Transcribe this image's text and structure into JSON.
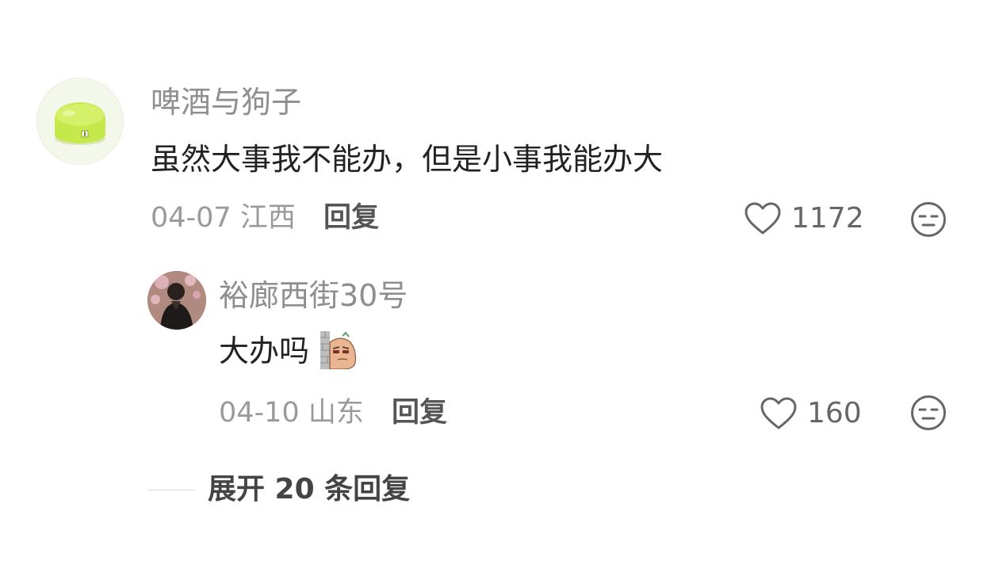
{
  "comment": {
    "username": "啤酒与狗子",
    "text": "虽然大事我不能办，但是小事我能办大",
    "date": "04-07",
    "location": "江西",
    "reply_label": "回复",
    "like_count": "1172",
    "avatar_icon": "green-toy-avatar",
    "like_icon": "heart-outline-icon",
    "dislike_icon": "unamused-face-icon"
  },
  "reply": {
    "username": "裕廊西街30号",
    "text": "大办吗",
    "emoji": "peeking-sticker",
    "date": "04-10",
    "location": "山东",
    "reply_label": "回复",
    "like_count": "160",
    "avatar_icon": "person-photo-avatar",
    "like_icon": "heart-outline-icon",
    "dislike_icon": "unamused-face-icon"
  },
  "expand": {
    "label": "展开 20 条回复"
  },
  "colors": {
    "username": "#8e8e8e",
    "text": "#222222",
    "meta": "#9a9a9a",
    "avatar_green": "#c5e84a"
  }
}
